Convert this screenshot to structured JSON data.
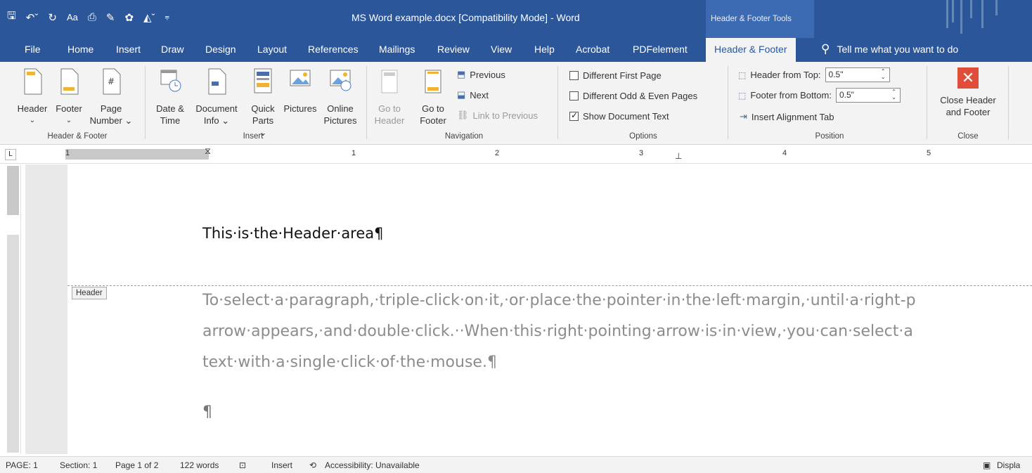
{
  "window": {
    "title": "MS Word example.docx [Compatibility Mode]  -  Word",
    "contextual_group": "Header & Footer Tools",
    "qat_icons": [
      "save-icon",
      "undo-icon",
      "redo-icon",
      "change-case-icon",
      "print-preview-icon",
      "draw-icon",
      "shapes-icon",
      "highlight-icon",
      "customize-qat-icon"
    ]
  },
  "tabs": [
    "File",
    "Home",
    "Insert",
    "Draw",
    "Design",
    "Layout",
    "References",
    "Mailings",
    "Review",
    "View",
    "Help",
    "Acrobat",
    "PDFelement",
    "Header & Footer"
  ],
  "active_tab": "Header & Footer",
  "tellme": "Tell me what you want to do",
  "ribbon": {
    "header_footer": {
      "label": "Header & Footer",
      "header": "Header",
      "footer": "Footer",
      "page_number_1": "Page",
      "page_number_2": "Number"
    },
    "insert": {
      "label": "Insert",
      "date_time_1": "Date &",
      "date_time_2": "Time",
      "doc_info_1": "Document",
      "doc_info_2": "Info",
      "quick_parts_1": "Quick",
      "quick_parts_2": "Parts",
      "pictures": "Pictures",
      "online_pictures_1": "Online",
      "online_pictures_2": "Pictures"
    },
    "navigation": {
      "label": "Navigation",
      "goto_header_1": "Go to",
      "goto_header_2": "Header",
      "goto_footer_1": "Go to",
      "goto_footer_2": "Footer",
      "previous": "Previous",
      "next": "Next",
      "link_previous": "Link to Previous"
    },
    "options": {
      "label": "Options",
      "diff_first": "Different First Page",
      "diff_odd_even": "Different Odd & Even Pages",
      "show_doc_text": "Show Document Text",
      "diff_first_checked": false,
      "diff_odd_even_checked": false,
      "show_doc_text_checked": true
    },
    "position": {
      "label": "Position",
      "header_from_top": "Header from Top:",
      "header_from_top_value": "0.5\"",
      "footer_from_bottom": "Footer from Bottom:",
      "footer_from_bottom_value": "0.5\"",
      "insert_alignment_tab": "Insert Alignment Tab"
    },
    "close": {
      "label": "Close",
      "close_1": "Close Header",
      "close_2": "and Footer"
    }
  },
  "ruler": {
    "corner": "L",
    "numbers": [
      "1",
      "1",
      "2",
      "3",
      "4",
      "5"
    ]
  },
  "document": {
    "header_text": "This·is·the·Header·area¶",
    "header_tag": "Header",
    "line1": "To·select·a·paragraph,·triple-click·on·it,·or·place·the·pointer·in·the·left·margin,·until·a·right-p",
    "line2": "arrow·appears,·and·double·click.··When·this·right·pointing·arrow·is·in·view,·you·can·select·a",
    "line3": "text·with·a·single·click·of·the·mouse.¶",
    "pilcrow": "¶"
  },
  "status": {
    "page": "PAGE: 1",
    "section": "Section: 1",
    "page_of": "Page 1 of 2",
    "words": "122 words",
    "mode": "Insert",
    "accessibility": "Accessibility: Unavailable",
    "display": "Displa"
  }
}
